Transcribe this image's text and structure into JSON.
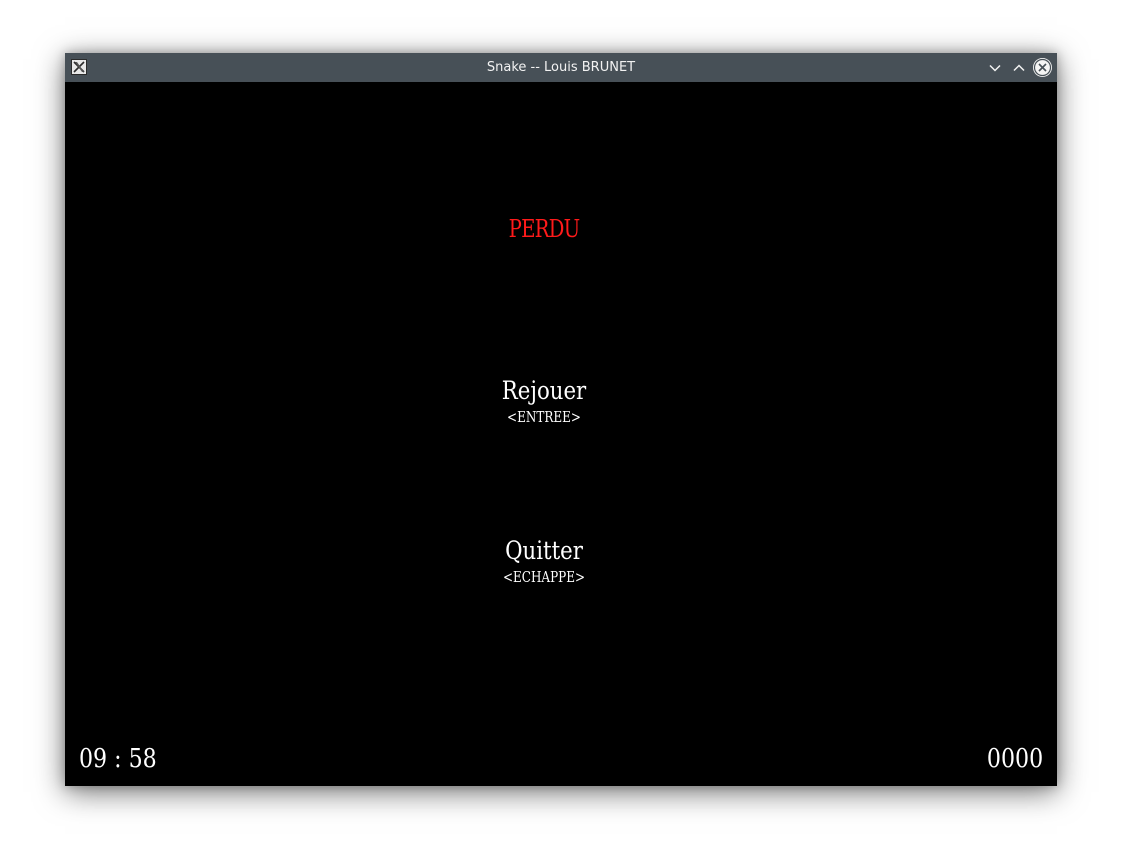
{
  "window": {
    "title": "Snake -- Louis BRUNET",
    "icons": {
      "app": "x11-app-icon",
      "minimize": "chevron-down-icon",
      "maximize": "chevron-up-icon",
      "close": "close-icon"
    }
  },
  "game": {
    "status_text": "PERDU",
    "status_color": "#ff1a1a",
    "menu": [
      {
        "label": "Rejouer",
        "key_hint": "<ENTREE>"
      },
      {
        "label": "Quitter",
        "key_hint": "<ECHAPPE>"
      }
    ],
    "timer": "09 : 58",
    "score": "0000"
  }
}
